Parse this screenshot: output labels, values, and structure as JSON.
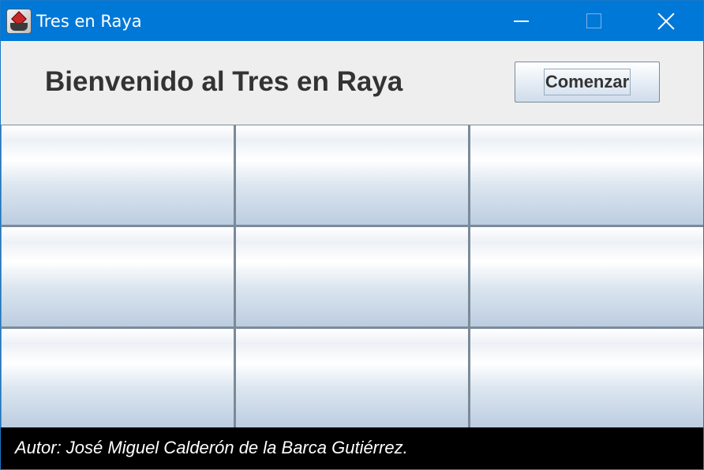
{
  "window": {
    "title": "Tres en Raya",
    "icon": "java-app-icon"
  },
  "title_controls": {
    "minimize_icon": "minimize-icon",
    "maximize_icon": "maximize-icon",
    "close_icon": "close-icon"
  },
  "header": {
    "welcome_text": "Bienvenido al Tres en Raya",
    "start_button_label": "Comenzar"
  },
  "board": {
    "rows": 3,
    "cols": 3,
    "cells": [
      "",
      "",
      "",
      "",
      "",
      "",
      "",
      "",
      ""
    ]
  },
  "footer": {
    "author_text": "Autor: José Miguel Calderón de la Barca Gutiérrez."
  },
  "colors": {
    "titlebar": "#0078d7",
    "footer": "#000000",
    "grid_lines": "#7a8a99"
  }
}
